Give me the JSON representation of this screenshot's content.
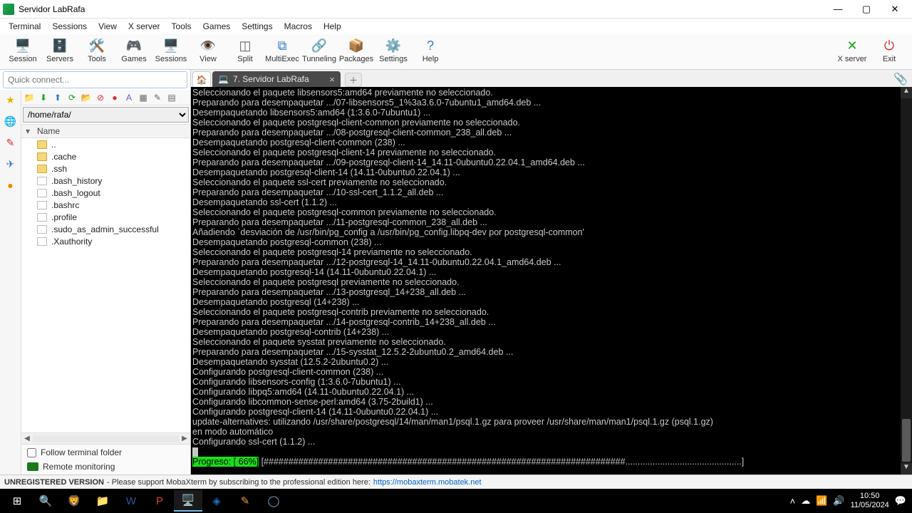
{
  "window": {
    "title": "Servidor LabRafa"
  },
  "menu": [
    "Terminal",
    "Sessions",
    "View",
    "X server",
    "Tools",
    "Games",
    "Settings",
    "Macros",
    "Help"
  ],
  "toolbar": [
    {
      "label": "Session",
      "icon": "🖥️",
      "cls": "c-blue"
    },
    {
      "label": "Servers",
      "icon": "🗄️",
      "cls": "c-blue"
    },
    {
      "label": "Tools",
      "icon": "🛠️",
      "cls": "c-orange"
    },
    {
      "label": "Games",
      "icon": "🎮",
      "cls": "c-purple"
    },
    {
      "label": "Sessions",
      "icon": "🖥️",
      "cls": "c-blue"
    },
    {
      "label": "View",
      "icon": "👁️",
      "cls": "c-green"
    },
    {
      "label": "Split",
      "icon": "◫",
      "cls": "c-gray"
    },
    {
      "label": "MultiExec",
      "icon": "⧉",
      "cls": "c-blue"
    },
    {
      "label": "Tunneling",
      "icon": "🔗",
      "cls": "c-blue"
    },
    {
      "label": "Packages",
      "icon": "📦",
      "cls": "c-orange"
    },
    {
      "label": "Settings",
      "icon": "⚙️",
      "cls": "c-gray"
    },
    {
      "label": "Help",
      "icon": "?",
      "cls": "c-blue"
    }
  ],
  "toolbar_right": [
    {
      "label": "X server",
      "icon": "✕",
      "cls": "c-green"
    },
    {
      "label": "Exit",
      "icon": "⏻",
      "cls": "c-red"
    }
  ],
  "quick_connect_placeholder": "Quick connect...",
  "sidebar": {
    "path": "/home/rafa/",
    "header": "Name",
    "items": [
      {
        "name": "..",
        "type": "dir"
      },
      {
        "name": ".cache",
        "type": "dir"
      },
      {
        "name": ".ssh",
        "type": "dir"
      },
      {
        "name": ".bash_history",
        "type": "file"
      },
      {
        "name": ".bash_logout",
        "type": "file"
      },
      {
        "name": ".bashrc",
        "type": "file"
      },
      {
        "name": ".profile",
        "type": "file"
      },
      {
        "name": ".sudo_as_admin_successful",
        "type": "file"
      },
      {
        "name": ".Xauthority",
        "type": "file"
      }
    ],
    "follow_label": "Follow terminal folder",
    "remote_mon_label": "Remote monitoring"
  },
  "tab": {
    "label": "7. Servidor LabRafa"
  },
  "terminal_lines": [
    "Seleccionando el paquete libsensors5:amd64 previamente no seleccionado.",
    "Preparando para desempaquetar .../07-libsensors5_1%3a3.6.0-7ubuntu1_amd64.deb ...",
    "Desempaquetando libsensors5:amd64 (1:3.6.0-7ubuntu1) ...",
    "Seleccionando el paquete postgresql-client-common previamente no seleccionado.",
    "Preparando para desempaquetar .../08-postgresql-client-common_238_all.deb ...",
    "Desempaquetando postgresql-client-common (238) ...",
    "Seleccionando el paquete postgresql-client-14 previamente no seleccionado.",
    "Preparando para desempaquetar .../09-postgresql-client-14_14.11-0ubuntu0.22.04.1_amd64.deb ...",
    "Desempaquetando postgresql-client-14 (14.11-0ubuntu0.22.04.1) ...",
    "Seleccionando el paquete ssl-cert previamente no seleccionado.",
    "Preparando para desempaquetar .../10-ssl-cert_1.1.2_all.deb ...",
    "Desempaquetando ssl-cert (1.1.2) ...",
    "Seleccionando el paquete postgresql-common previamente no seleccionado.",
    "Preparando para desempaquetar .../11-postgresql-common_238_all.deb ...",
    "Añadiendo `desviación de /usr/bin/pg_config a /usr/bin/pg_config.libpq-dev por postgresql-common'",
    "Desempaquetando postgresql-common (238) ...",
    "Seleccionando el paquete postgresql-14 previamente no seleccionado.",
    "Preparando para desempaquetar .../12-postgresql-14_14.11-0ubuntu0.22.04.1_amd64.deb ...",
    "Desempaquetando postgresql-14 (14.11-0ubuntu0.22.04.1) ...",
    "Seleccionando el paquete postgresql previamente no seleccionado.",
    "Preparando para desempaquetar .../13-postgresql_14+238_all.deb ...",
    "Desempaquetando postgresql (14+238) ...",
    "Seleccionando el paquete postgresql-contrib previamente no seleccionado.",
    "Preparando para desempaquetar .../14-postgresql-contrib_14+238_all.deb ...",
    "Desempaquetando postgresql-contrib (14+238) ...",
    "Seleccionando el paquete sysstat previamente no seleccionado.",
    "Preparando para desempaquetar .../15-sysstat_12.5.2-2ubuntu0.2_amd64.deb ...",
    "Desempaquetando sysstat (12.5.2-2ubuntu0.2) ...",
    "Configurando postgresql-client-common (238) ...",
    "Configurando libsensors-config (1:3.6.0-7ubuntu1) ...",
    "Configurando libpq5:amd64 (14.11-0ubuntu0.22.04.1) ...",
    "Configurando libcommon-sense-perl:amd64 (3.75-2build1) ...",
    "Configurando postgresql-client-14 (14.11-0ubuntu0.22.04.1) ...",
    "update-alternatives: utilizando /usr/share/postgresql/14/man/man1/psql.1.gz para proveer /usr/share/man/man1/psql.1.gz (psql.1.gz)",
    "en modo automático",
    "Configurando ssl-cert (1.1.2) ..."
  ],
  "progress": {
    "label": "Progreso: [ 66%]",
    "bar": " [#########################################################################...............................................] "
  },
  "footer": {
    "unreg": "UNREGISTERED VERSION",
    "msg": " - Please support MobaXterm by subscribing to the professional edition here: ",
    "link": "https://mobaxterm.mobatek.net"
  },
  "clock": {
    "time": "10:50",
    "date": "11/05/2024"
  }
}
